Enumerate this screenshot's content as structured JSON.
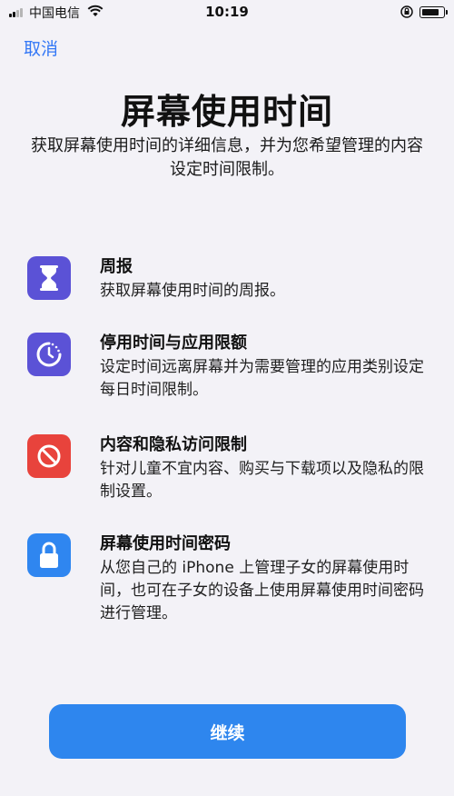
{
  "status_bar": {
    "carrier": "中国电信",
    "time": "10:19"
  },
  "nav": {
    "cancel_label": "取消"
  },
  "header": {
    "title": "屏幕使用时间",
    "subtitle": "获取屏幕使用时间的详细信息，并为您希望管理的内容设定时间限制。"
  },
  "features": [
    {
      "icon": "hourglass-icon",
      "color": "#5b52d6",
      "title": "周报",
      "description": "获取屏幕使用时间的周报。"
    },
    {
      "icon": "downtime-icon",
      "color": "#5b52d6",
      "title": "停用时间与应用限额",
      "description": "设定时间远离屏幕并为需要管理的应用类别设定每日时间限制。"
    },
    {
      "icon": "no-entry-icon",
      "color": "#e8433c",
      "title": "内容和隐私访问限制",
      "description": "针对儿童不宜内容、购买与下载项以及隐私的限制设置。"
    },
    {
      "icon": "lock-icon",
      "color": "#2f86f0",
      "title": "屏幕使用时间密码",
      "description": "从您自己的 iPhone 上管理子女的屏幕使用时间，也可在子女的设备上使用屏幕使用时间密码进行管理。"
    }
  ],
  "footer": {
    "continue_label": "继续"
  },
  "colors": {
    "accent": "#3478f6",
    "button": "#2e86ee",
    "background": "#f3f2f7"
  }
}
